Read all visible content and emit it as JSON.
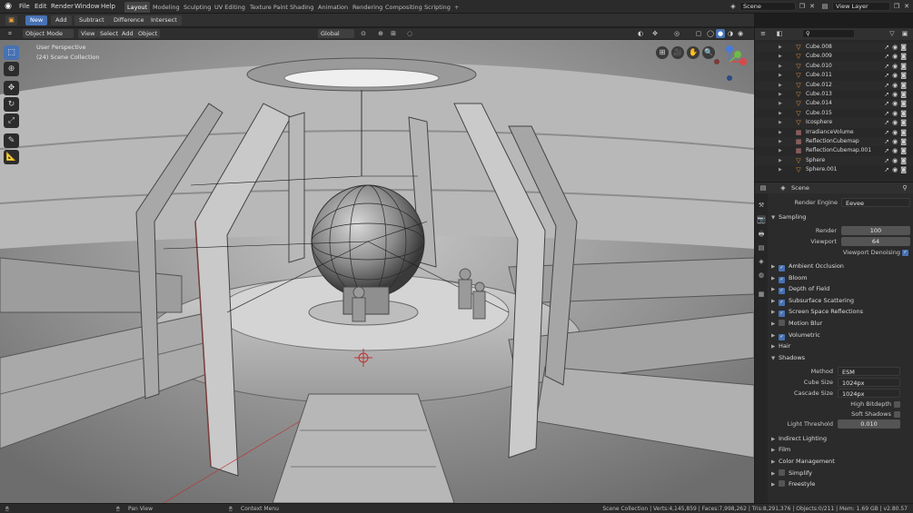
{
  "top_menu": [
    "File",
    "Edit",
    "Render",
    "Window",
    "Help"
  ],
  "workspace_tabs": [
    "Layout",
    "Modeling",
    "Sculpting",
    "UV Editing",
    "Texture Paint",
    "Shading",
    "Animation",
    "Rendering",
    "Compositing",
    "Scripting"
  ],
  "active_workspace": "Layout",
  "scene_field": "Scene",
  "view_layer_field": "View Layer",
  "boolean_tools": [
    "New",
    "Add",
    "Subtract",
    "Difference",
    "Intersect"
  ],
  "viewport_header": {
    "mode": "Object Mode",
    "menus": [
      "View",
      "Select",
      "Add",
      "Object"
    ],
    "orientation": "Global"
  },
  "viewport_overlay": {
    "perspective": "User Perspective",
    "collection": "(24) Scene Collection"
  },
  "outliner_items": [
    {
      "label": "Cube.008",
      "type": "mesh"
    },
    {
      "label": "Cube.009",
      "type": "mesh"
    },
    {
      "label": "Cube.010",
      "type": "mesh"
    },
    {
      "label": "Cube.011",
      "type": "mesh"
    },
    {
      "label": "Cube.012",
      "type": "mesh"
    },
    {
      "label": "Cube.013",
      "type": "mesh"
    },
    {
      "label": "Cube.014",
      "type": "mesh"
    },
    {
      "label": "Cube.015",
      "type": "mesh"
    },
    {
      "label": "Icosphere",
      "type": "mesh"
    },
    {
      "label": "IrradianceVolume",
      "type": "probe"
    },
    {
      "label": "ReflectionCubemap",
      "type": "probe"
    },
    {
      "label": "ReflectionCubemap.001",
      "type": "probe"
    },
    {
      "label": "Sphere",
      "type": "mesh"
    },
    {
      "label": "Sphere.001",
      "type": "mesh"
    }
  ],
  "properties": {
    "header": "Scene",
    "render_engine_label": "Render Engine",
    "render_engine": "Eevee",
    "sampling": "Sampling",
    "render_label": "Render",
    "render_value": "100",
    "viewport_label": "Viewport",
    "viewport_value": "64",
    "viewport_denoising": "Viewport Denoising",
    "panels": [
      {
        "label": "Ambient Occlusion",
        "checked": true
      },
      {
        "label": "Bloom",
        "checked": true
      },
      {
        "label": "Depth of Field",
        "checked": true
      },
      {
        "label": "Subsurface Scattering",
        "checked": true
      },
      {
        "label": "Screen Space Reflections",
        "checked": true
      },
      {
        "label": "Motion Blur",
        "checked": false
      },
      {
        "label": "Volumetric",
        "checked": true
      }
    ],
    "hair": "Hair",
    "shadows": "Shadows",
    "method_label": "Method",
    "method": "ESM",
    "cube_size_label": "Cube Size",
    "cube_size": "1024px",
    "cascade_size_label": "Cascade Size",
    "cascade_size": "1024px",
    "high_bitdepth": "High Bitdepth",
    "soft_shadows": "Soft Shadows",
    "light_threshold_label": "Light Threshold",
    "light_threshold": "0.010",
    "bottom_panels": [
      "Indirect Lighting",
      "Film",
      "Color Management"
    ],
    "simplify": "Simplify",
    "freestyle": "Freestyle"
  },
  "status": {
    "pan": "Pan View",
    "context": "Context Menu",
    "stats": "Scene Collection | Verts:4,145,859 | Faces:7,998,262 | Tris:8,291,376 | Objects:0/211 | Mem: 1.69 GB | v2.80.57"
  },
  "colors": {
    "accent": "#4772b3",
    "background": "#2b2b2b",
    "viewport": "#7a7a7a",
    "mesh_icon": "#e8953a"
  }
}
